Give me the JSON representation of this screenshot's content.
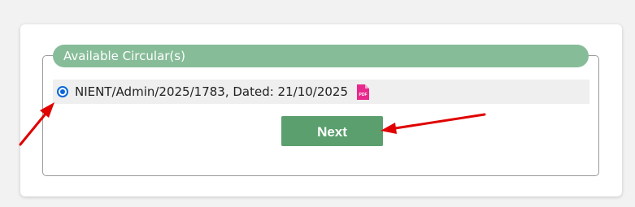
{
  "panel": {
    "legend_title": "Available Circular(s)"
  },
  "circulars": [
    {
      "label": "NIENT/Admin/2025/1783, Dated: 21/10/2025",
      "selected": true,
      "attachment_icon": "pdf-icon",
      "attachment_icon_text": "PDF"
    }
  ],
  "actions": {
    "next_label": "Next"
  },
  "colors": {
    "legend_bg": "#86bc98",
    "button_bg": "#5a9f6d",
    "radio_accent": "#0a66d8",
    "pdf_icon": "#e8288c",
    "annotation_arrow": "#e00000"
  }
}
